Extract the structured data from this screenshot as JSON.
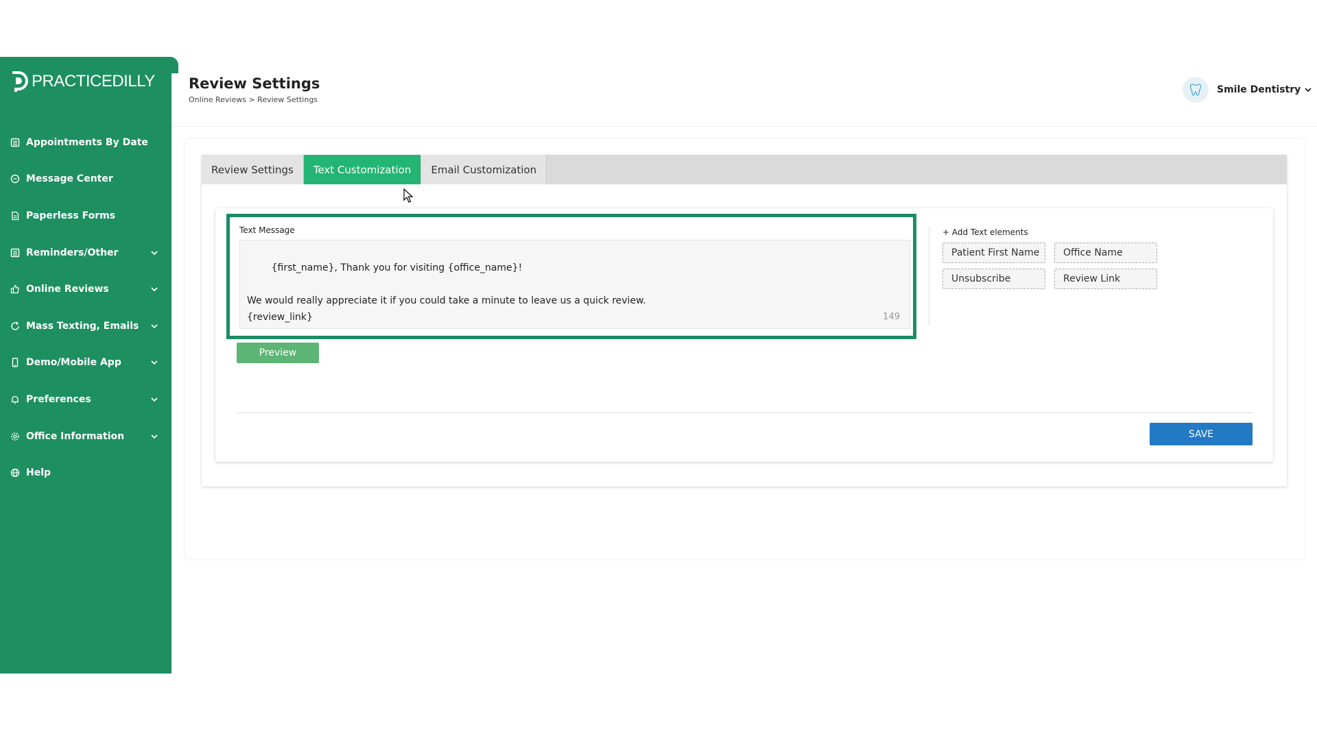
{
  "brand": {
    "name": "PRACTICEDILLY",
    "color": "#1d8f60",
    "accent": "#22b573"
  },
  "sidebar": {
    "items": [
      {
        "label": "Appointments By Date",
        "icon": "calendar-icon",
        "expandable": false
      },
      {
        "label": "Message Center",
        "icon": "chat-icon",
        "expandable": false
      },
      {
        "label": "Paperless Forms",
        "icon": "document-icon",
        "expandable": false
      },
      {
        "label": "Reminders/Other",
        "icon": "list-icon",
        "expandable": true
      },
      {
        "label": "Online Reviews",
        "icon": "thumbs-up-icon",
        "expandable": true
      },
      {
        "label": "Mass Texting, Emails",
        "icon": "refresh-icon",
        "expandable": true
      },
      {
        "label": "Demo/Mobile App",
        "icon": "mobile-icon",
        "expandable": true
      },
      {
        "label": "Preferences",
        "icon": "bell-icon",
        "expandable": true
      },
      {
        "label": "Office Information",
        "icon": "gear-icon",
        "expandable": true
      },
      {
        "label": "Help",
        "icon": "globe-icon",
        "expandable": false
      }
    ]
  },
  "header": {
    "title": "Review Settings",
    "breadcrumb": "Online Reviews > Review Settings",
    "user": "Smile Dentistry"
  },
  "tabs": [
    {
      "label": "Review Settings",
      "active": false
    },
    {
      "label": "Text Customization",
      "active": true
    },
    {
      "label": "Email Customization",
      "active": false
    }
  ],
  "text_message": {
    "label": "Text Message",
    "value": "{first_name}, Thank you for visiting {office_name}!\n\nWe would really appreciate it if you could take a minute to leave us a quick review.\n{review_link}",
    "char_count": "149"
  },
  "buttons": {
    "preview": "Preview",
    "save": "SAVE"
  },
  "text_elements": {
    "label": "+ Add Text elements",
    "chips": [
      "Patient First Name",
      "Office Name",
      "Unsubscribe",
      "Review Link"
    ]
  }
}
